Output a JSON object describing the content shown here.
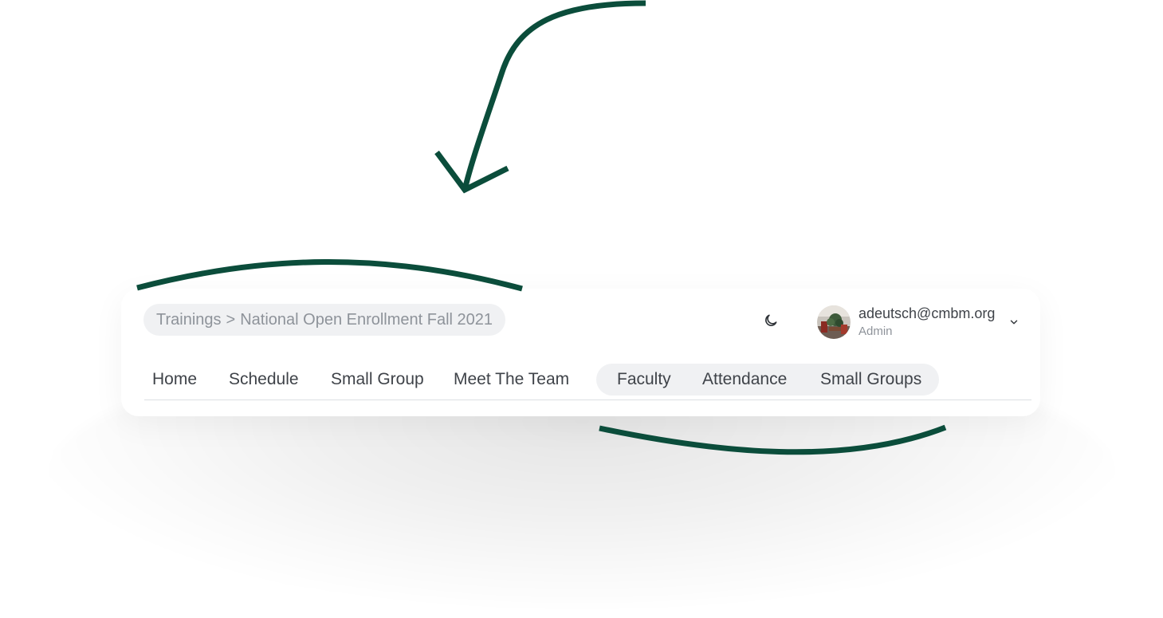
{
  "breadcrumb": {
    "parent": "Trainings",
    "separator": ">",
    "current": "National Open Enrollment Fall 2021"
  },
  "header": {
    "theme_toggle_icon": "moon-icon",
    "user": {
      "email": "adeutsch@cmbm.org",
      "role": "Admin",
      "avatar_icon": "avatar-photo",
      "menu_icon": "chevron-down-icon"
    }
  },
  "nav": {
    "items": [
      {
        "label": "Home"
      },
      {
        "label": "Schedule"
      },
      {
        "label": "Small Group"
      },
      {
        "label": "Meet The Team"
      }
    ],
    "admin_items": [
      {
        "label": "Faculty"
      },
      {
        "label": "Attendance"
      },
      {
        "label": "Small Groups"
      }
    ]
  },
  "colors": {
    "annotation": "#0b4d3b",
    "pill_background": "#f0f1f3",
    "text_primary": "#3f4349",
    "text_muted": "#8e939a"
  }
}
